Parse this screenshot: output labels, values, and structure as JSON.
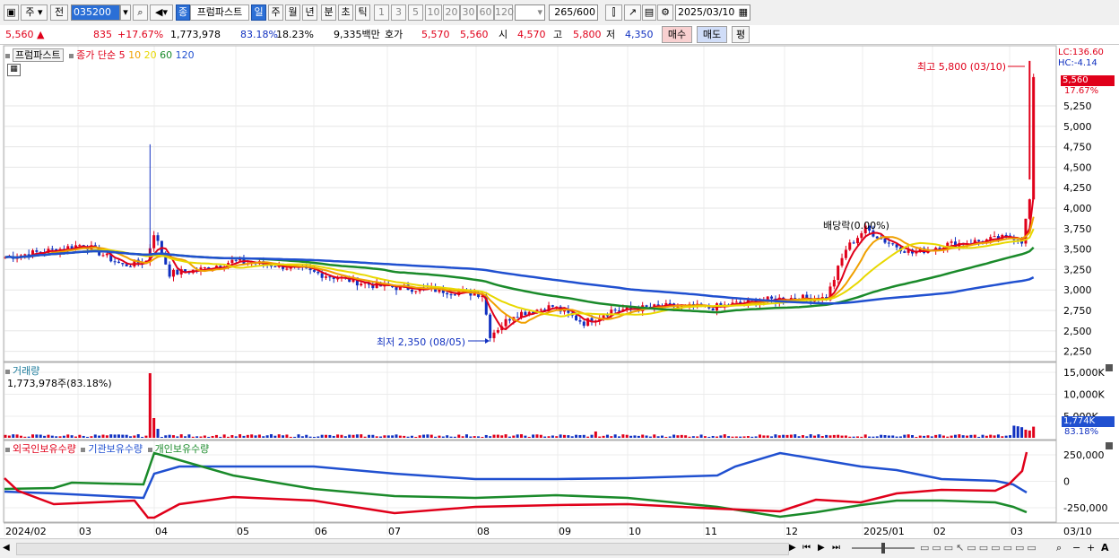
{
  "toolbar": {
    "type_label": "주",
    "prev_label": "전",
    "code_value": "035200",
    "stock_badge": "종",
    "stock_name": "프럼파스트",
    "periods": [
      "일",
      "주",
      "월",
      "년",
      "분",
      "초",
      "틱"
    ],
    "active_period": "일",
    "intervals": [
      "1",
      "3",
      "5",
      "10",
      "20",
      "30",
      "60",
      "120"
    ],
    "count_value": "265",
    "count_total": "/600",
    "date_value": "2025/03/10"
  },
  "quote": {
    "price": "5,560",
    "arrow": "▲",
    "change": "835",
    "change_pct": "+17.67%",
    "volume": "1,773,978",
    "vol_ratio": "83.18%",
    "turnover": "18.23%",
    "amount": "9,335백만",
    "ask_label": "호가",
    "ask": "5,570",
    "bid": "5,560",
    "open_label": "시",
    "open": "4,570",
    "high_label": "고",
    "high": "5,800",
    "low_label": "저",
    "low": "4,350",
    "buy_label": "매수",
    "sell_label": "매도",
    "eval_label": "평"
  },
  "price_pane": {
    "stock_tag": "프럼파스트",
    "ma_label": "종가 단순",
    "ma_periods": [
      {
        "label": "5",
        "color": "#e0001a"
      },
      {
        "label": "10",
        "color": "#f0a000"
      },
      {
        "label": "20",
        "color": "#e8d800"
      },
      {
        "label": "60",
        "color": "#1a8a2a"
      },
      {
        "label": "120",
        "color": "#2050d0"
      }
    ],
    "lc_label": "LC:136.60",
    "hc_label": "HC:-4.14",
    "current_tag": "5,560",
    "current_pct": "17.67%",
    "high_annot": "최고 5,800 (03/10)",
    "low_annot": "최저 2,350 (08/05)",
    "ex_annot": "배당락(0.00%)",
    "y_ticks": [
      "5,250",
      "5,000",
      "4,750",
      "4,500",
      "4,250",
      "4,000",
      "3,750",
      "3,500",
      "3,250",
      "3,000",
      "2,750",
      "2,500",
      "2,250"
    ]
  },
  "volume_pane": {
    "title": "거래량",
    "value": "1,773,978주(83.18%)",
    "y_ticks": [
      "15,000K",
      "10,000K",
      "5,000K"
    ],
    "current_tag": "1,774K",
    "current_pct": "83.18%"
  },
  "holder_pane": {
    "legend": [
      {
        "label": "외국인보유수량",
        "color": "#e0001a"
      },
      {
        "label": "기관보유수량",
        "color": "#2050d0"
      },
      {
        "label": "개인보유수량",
        "color": "#1a8a2a"
      }
    ],
    "y_ticks": [
      "250,000",
      "0",
      "-250,000"
    ]
  },
  "x_axis": [
    "2024/02",
    "03",
    "04",
    "05",
    "06",
    "07",
    "08",
    "09",
    "10",
    "11",
    "12",
    "2025/01",
    "02",
    "03"
  ],
  "x_right_label": "03/10"
}
